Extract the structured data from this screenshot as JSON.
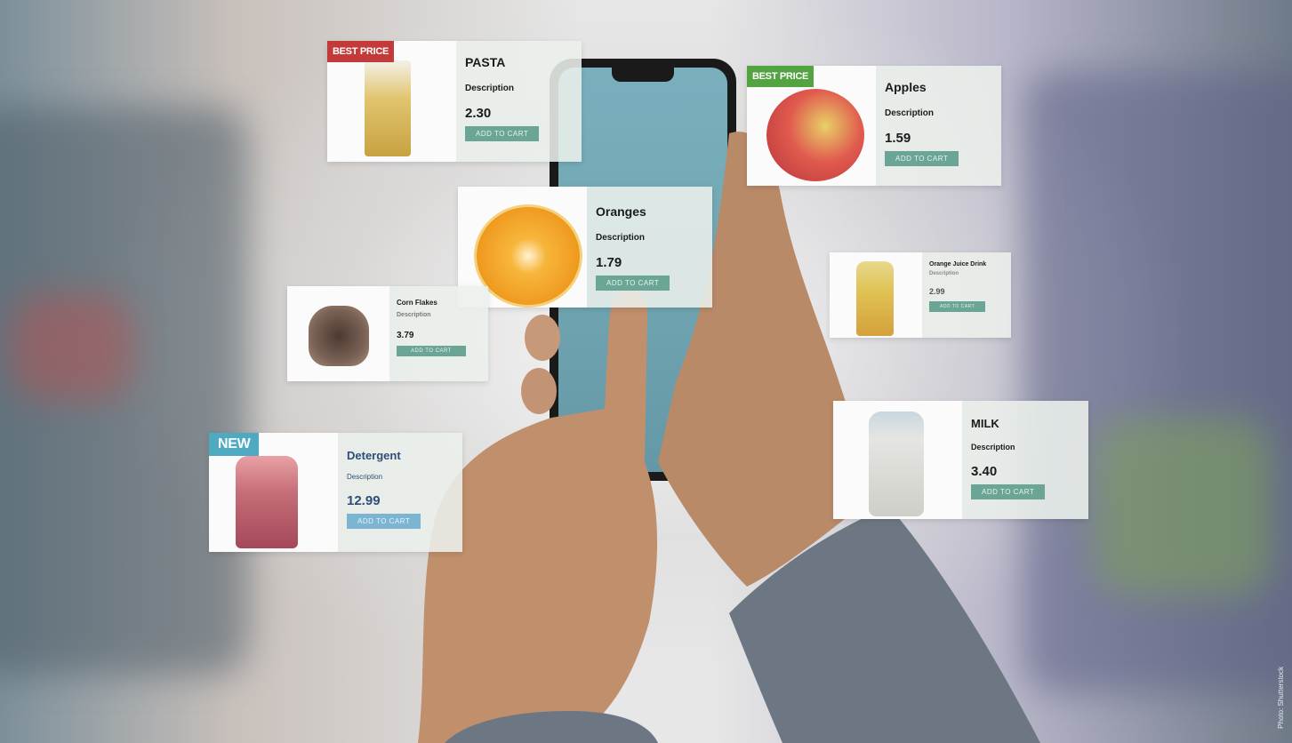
{
  "scene": {
    "description_visible": false,
    "credit": "Photo: Shutterstock"
  },
  "cards": {
    "pasta": {
      "badge": "BEST PRICE",
      "name": "PASTA",
      "desc": "Description",
      "price": "2.30",
      "cart": "ADD TO CART"
    },
    "apples": {
      "badge": "BEST PRICE",
      "name": "Apples",
      "desc": "Description",
      "price": "1.59",
      "cart": "ADD TO CART"
    },
    "oranges": {
      "name": "Oranges",
      "desc": "Description",
      "price": "1.79",
      "cart": "ADD TO CART"
    },
    "cornflakes": {
      "name": "Corn Flakes",
      "desc": "Description",
      "price": "3.79",
      "cart": "ADD TO CART"
    },
    "orangejuice": {
      "name": "Orange Juice Drink",
      "desc": "Description",
      "price": "2.99",
      "cart": "ADD TO CART"
    },
    "detergent": {
      "badge": "NEW",
      "name": "Detergent",
      "desc": "Description",
      "price": "12.99",
      "cart": "ADD TO CART"
    },
    "milk": {
      "name": "MILK",
      "desc": "Description",
      "price": "3.40",
      "cart": "ADD TO CART"
    }
  },
  "colors": {
    "badge_red": "#c23a3a",
    "badge_green": "#53a340",
    "badge_teal": "#4eaac1",
    "cart_button": "#6aa596"
  }
}
